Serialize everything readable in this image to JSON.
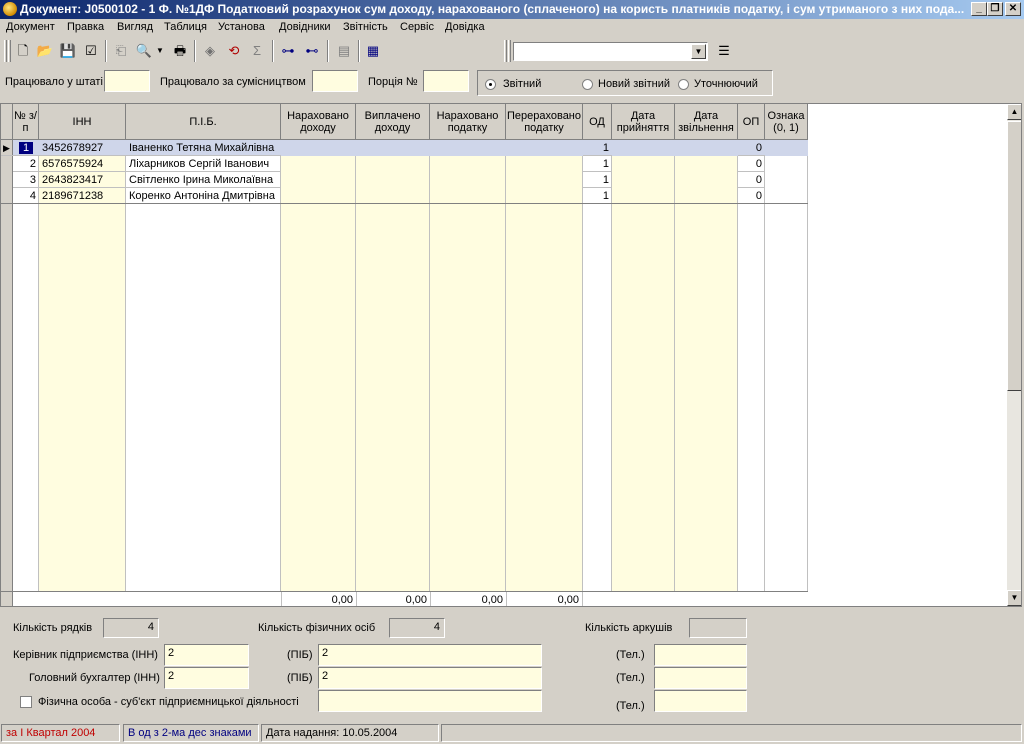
{
  "window": {
    "title": "Документ: J0500102 - 1  Ф. №1ДФ Податковий розрахунок сум доходу, нарахованого (сплаченого) на користь платників податку, і сум утриманого з них пода..."
  },
  "menu": [
    "Документ",
    "Правка",
    "Вигляд",
    "Таблиця",
    "Установа",
    "Довідники",
    "Звітність",
    "Сервіс",
    "Довідка"
  ],
  "toolbar": {
    "combo_value": ""
  },
  "header_fields": {
    "staff_label": "Працювало у штаті",
    "staff_value": "",
    "parttime_label": "Працювало за сумісництвом",
    "parttime_value": "",
    "portion_label": "Порція №",
    "portion_value": ""
  },
  "report_type": {
    "options": [
      "Звітний",
      "Новий звітний",
      "Уточнюючий"
    ],
    "selected": "Звітний"
  },
  "table": {
    "columns": [
      "№ з/п",
      "ІНН",
      "П.І.Б.",
      "Нараховано доходу",
      "Виплачено доходу",
      "Нараховано податку",
      "Перераховано податку",
      "ОД",
      "Дата прийняття",
      "Дата звільнення",
      "ОП",
      "Ознака (0, 1)"
    ],
    "rows": [
      {
        "n": "1",
        "inn": "3452678927",
        "name": "Іваненко Тетяна Михайлівна",
        "od": "1",
        "op": "0"
      },
      {
        "n": "2",
        "inn": "6576575924",
        "name": "Ліхарников Сергій Іванович",
        "od": "1",
        "op": "0"
      },
      {
        "n": "3",
        "inn": "2643823417",
        "name": "Світленко Ірина Миколаївна",
        "od": "1",
        "op": "0"
      },
      {
        "n": "4",
        "inn": "2189671238",
        "name": "Коренко Антоніна Дмитрівна",
        "od": "1",
        "op": "0"
      }
    ],
    "totals": {
      "accrued_income": "0,00",
      "paid_income": "0,00",
      "accrued_tax": "0,00",
      "transferred_tax": "0,00"
    }
  },
  "footer": {
    "rows_label": "Кількість рядків",
    "rows_value": "4",
    "persons_label": "Кількість фізичних осіб",
    "persons_value": "4",
    "sheets_label": "Кількість аркушів",
    "sheets_value": "",
    "director_label": "Керівник підприємства (ІНН)",
    "director_inn": "2",
    "pib_label": "(ПІБ)",
    "director_pib": "2",
    "phone_label": "(Тел.)",
    "director_phone": "",
    "accountant_label": "Головний бухгалтер (ІНН)",
    "accountant_inn": "2",
    "accountant_pib": "2",
    "accountant_phone": "",
    "entrepreneur_label": "Фізична особа - суб'єкт підприємницької діяльності",
    "entrepreneur_value": "",
    "entrepreneur_phone": ""
  },
  "status": {
    "period": "за I Квартал 2004",
    "units": "В од з 2-ма дес знаками",
    "date": "Дата надання: 10.05.2004",
    "period_color": "#c00000",
    "units_color": "#000080"
  }
}
